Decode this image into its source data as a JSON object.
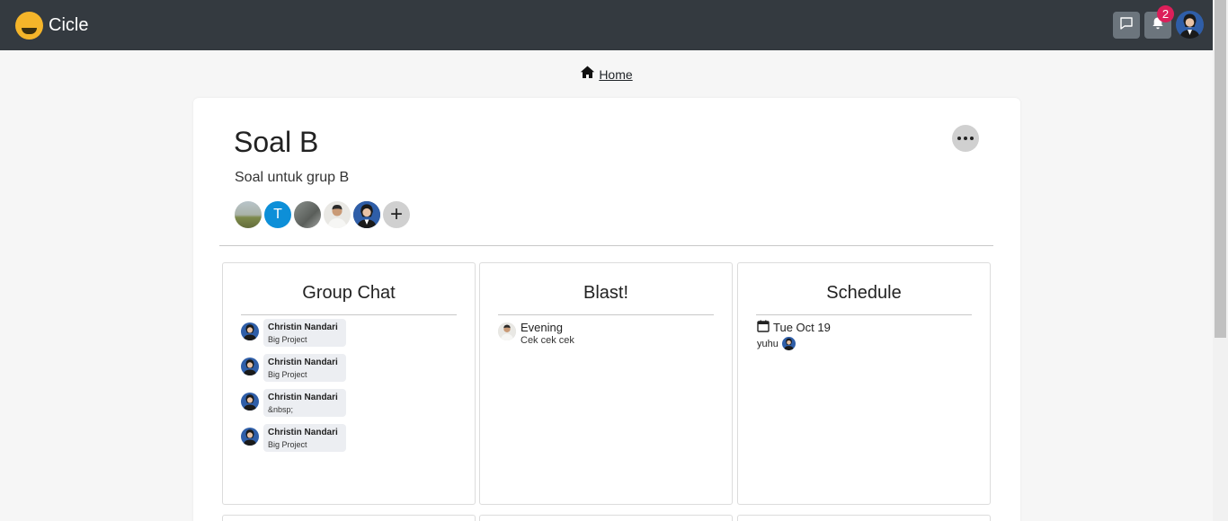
{
  "app": {
    "name": "Cicle"
  },
  "topbar": {
    "notification_count": "2"
  },
  "breadcrumb": {
    "home_label": "Home"
  },
  "project": {
    "title": "Soal B",
    "description": "Soal untuk grup B",
    "member_initial": "T",
    "add_member_symbol": "+"
  },
  "group_chat": {
    "title": "Group Chat",
    "messages": [
      {
        "sender": "Christin Nandari",
        "text": "Big Project"
      },
      {
        "sender": "Christin Nandari",
        "text": "Big Project"
      },
      {
        "sender": "Christin Nandari",
        "text": "&nbsp;"
      },
      {
        "sender": "Christin Nandari",
        "text": "Big Project"
      }
    ]
  },
  "blast": {
    "title": "Blast!",
    "posts": [
      {
        "title": "Evening",
        "text": "Cek cek cek"
      }
    ]
  },
  "schedule": {
    "title": "Schedule",
    "date": "Tue Oct 19",
    "events": [
      {
        "title": "yuhu"
      }
    ]
  },
  "colors": {
    "topbar": "#343a40",
    "badge": "#dc1f5a",
    "logo": "#f5b52a"
  },
  "icons": {
    "chat": "chat-icon",
    "bell": "bell-icon",
    "home": "home-icon",
    "more": "more-horizontal-icon",
    "calendar": "calendar-icon",
    "add": "plus-icon"
  }
}
